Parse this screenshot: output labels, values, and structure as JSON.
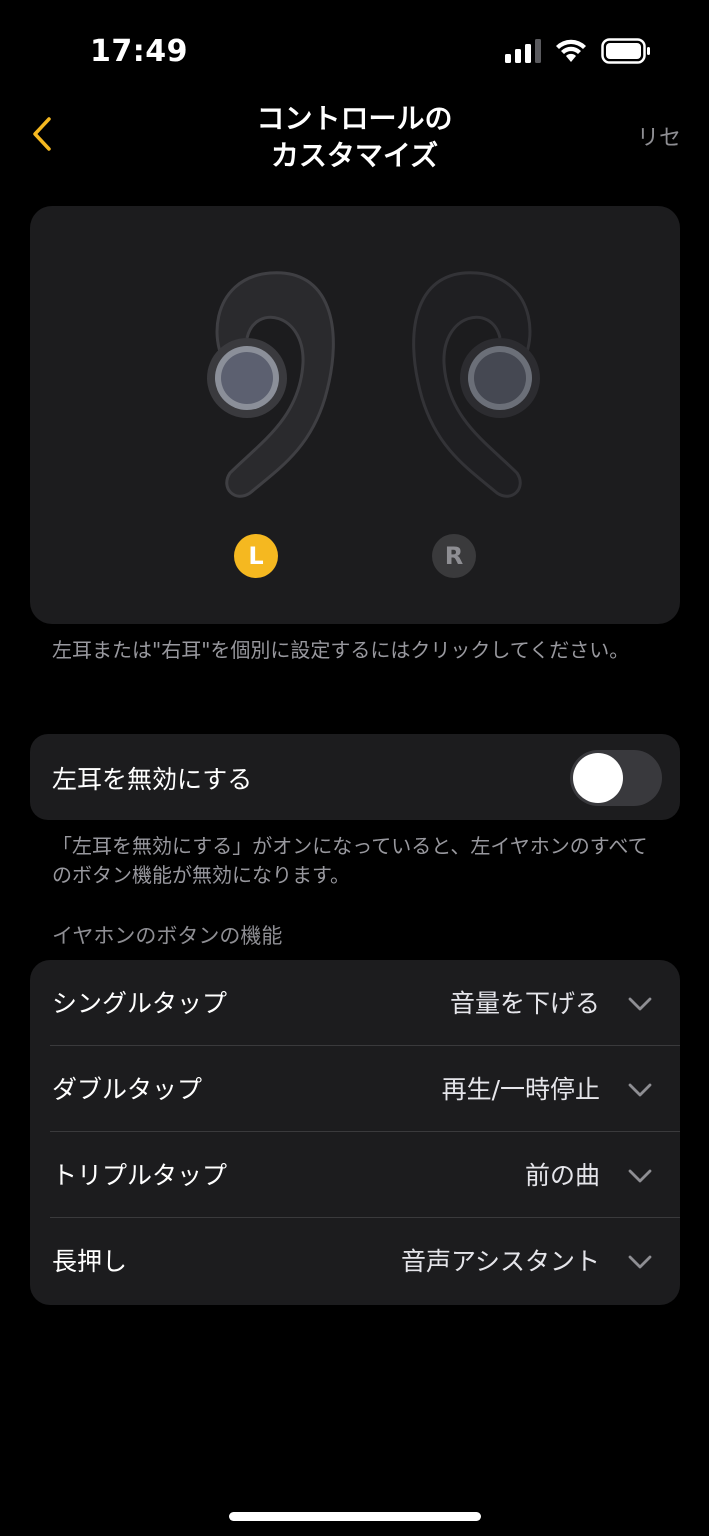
{
  "status_bar": {
    "time": "17:49"
  },
  "header": {
    "title_line1": "コントロールの",
    "title_line2": "カスタマイズ",
    "reset_label": "リセ"
  },
  "earbuds": {
    "left_label": "L",
    "right_label": "R"
  },
  "hint_select": "左耳または\"右耳\"を個別に設定するにはクリックしてください。",
  "disable_left": {
    "label": "左耳を無効にする",
    "enabled": false,
    "hint": "「左耳を無効にする」がオンになっていると、左イヤホンのすべてのボタン機能が無効になります。"
  },
  "section_title": "イヤホンのボタンの機能",
  "functions": [
    {
      "label": "シングルタップ",
      "value": "音量を下げる"
    },
    {
      "label": "ダブルタップ",
      "value": "再生/一時停止"
    },
    {
      "label": "トリプルタップ",
      "value": "前の曲"
    },
    {
      "label": "長押し",
      "value": "音声アシスタント"
    }
  ],
  "colors": {
    "accent": "#f5b820",
    "card_bg": "#1c1c1e",
    "secondary_text": "#8e8e93"
  }
}
